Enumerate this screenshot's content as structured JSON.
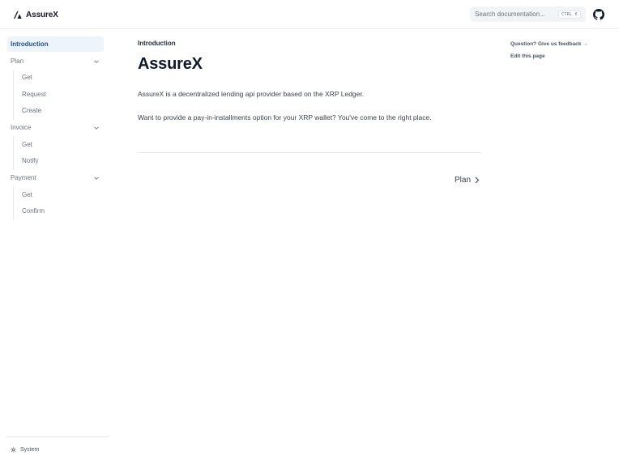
{
  "header": {
    "logo_text": "AssureX",
    "search_placeholder": "Search documentation...",
    "search_shortcut": "CTRL K"
  },
  "sidebar": {
    "items": [
      {
        "label": "Introduction",
        "active": true
      },
      {
        "label": "Plan",
        "expandable": true,
        "children": [
          "Get",
          "Request",
          "Create"
        ]
      },
      {
        "label": "Invoice",
        "expandable": true,
        "children": [
          "Get",
          "Notify"
        ]
      },
      {
        "label": "Payment",
        "expandable": true,
        "children": [
          "Get",
          "Confirm"
        ]
      }
    ],
    "theme_label": "System"
  },
  "main": {
    "breadcrumb": "Introduction",
    "title": "AssureX",
    "paragraphs": [
      "AssureX is a decentralized lending api provider based on the XRP Ledger.",
      "Want to provide a pay-in-installments option for your XRP wallet? You've come to the right place."
    ],
    "next_label": "Plan"
  },
  "toc": {
    "feedback": "Question? Give us feedback →",
    "edit": "Edit this page"
  },
  "colors": {
    "active_bg": "#eef4fb",
    "active_text": "#1d4e89"
  }
}
